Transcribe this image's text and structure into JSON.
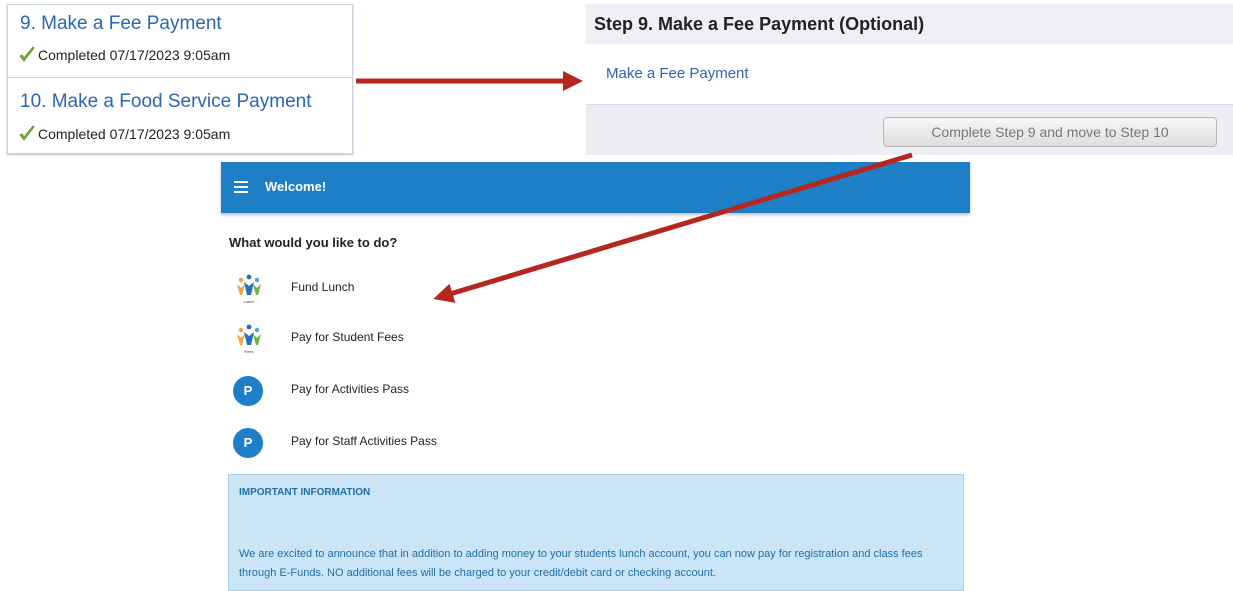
{
  "steps_list": {
    "items": [
      {
        "title": "9. Make a Fee Payment",
        "status": "Completed 07/17/2023 9:05am"
      },
      {
        "title": "10. Make a Food Service Payment",
        "status": "Completed 07/17/2023 9:05am"
      }
    ]
  },
  "step_panel": {
    "title": "Step 9. Make a Fee Payment (Optional)",
    "link": "Make a Fee Payment",
    "button": "Complete Step 9 and move to Step 10"
  },
  "app": {
    "title": "Welcome!",
    "prompt": "What would you like to do?",
    "options": [
      {
        "label": "Fund Lunch",
        "icon": "lunch-people-icon",
        "icon_caption": "Lunch"
      },
      {
        "label": "Pay for Student Fees",
        "icon": "fees-people-icon",
        "icon_caption": "Fees"
      },
      {
        "label": "Pay for Activities Pass",
        "icon": "p-badge-icon",
        "badge": "P"
      },
      {
        "label": "Pay for Staff Activities Pass",
        "icon": "p-badge-icon",
        "badge": "P"
      }
    ],
    "info": {
      "title": "IMPORTANT INFORMATION",
      "text": "We are excited to announce that in addition to adding money to your students lunch account, you can now pay for registration and class fees through E-Funds. NO additional fees will be charged to your credit/debit card or checking account."
    }
  },
  "colors": {
    "link_blue": "#2a66b5",
    "header_blue": "#1f7fc6",
    "arrow_red": "#b5261e",
    "info_bg": "#cce5f6"
  }
}
